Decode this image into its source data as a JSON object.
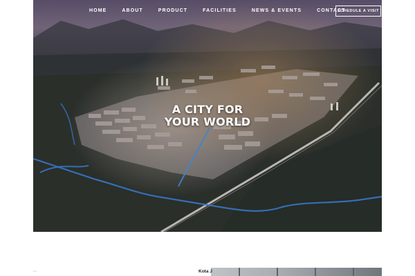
{
  "nav": {
    "links": [
      "HOME",
      "ABOUT",
      "PRODUCT",
      "FACILITIES",
      "NEWS & EVENTS",
      "CONTACT"
    ],
    "cta_label": "SCHEDULE A VISIT"
  },
  "hero": {
    "headline_line1": "A CITY FOR",
    "headline_line2": "YOUR WORLD",
    "image": "aerial-city-icon"
  },
  "below": {
    "logo_text": "∷∷",
    "section_title": "Kota J"
  },
  "colors": {
    "text_light": "#ffffff",
    "overlay_top": "#6b5a7a",
    "river": "#3d7fd6"
  }
}
